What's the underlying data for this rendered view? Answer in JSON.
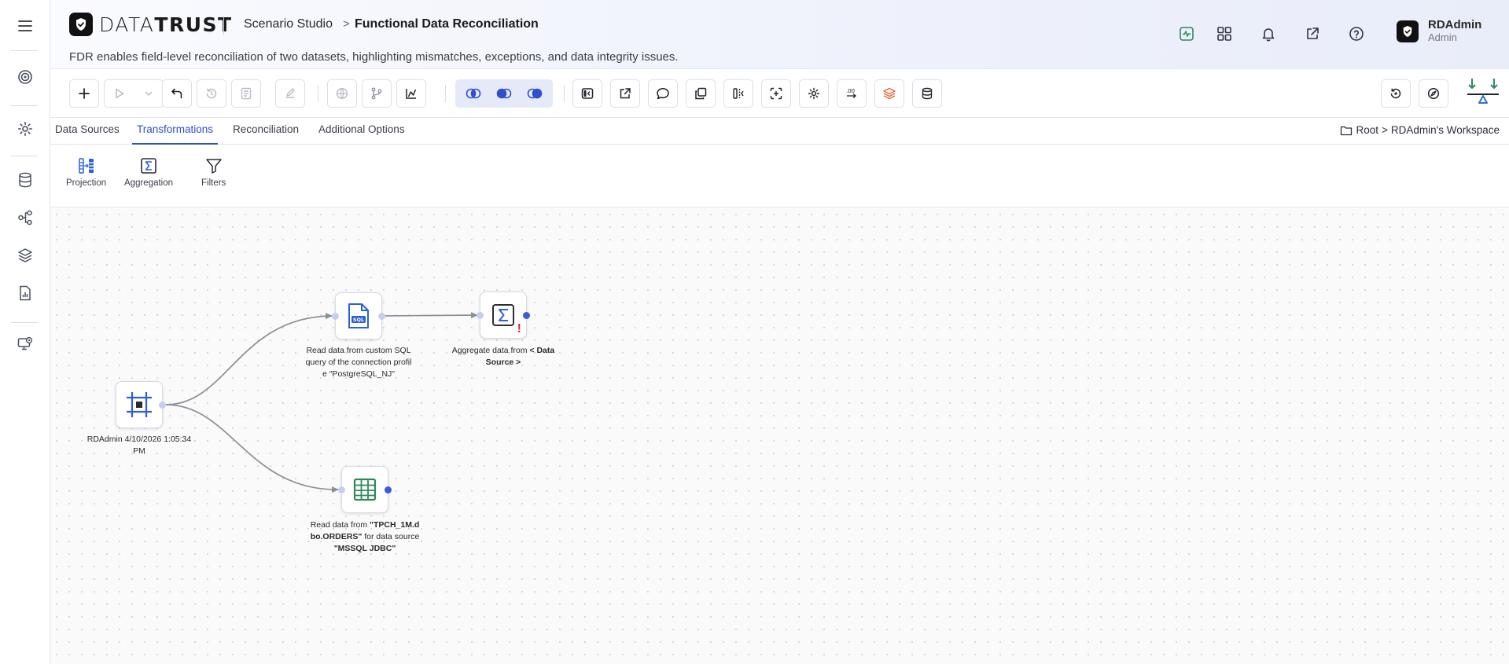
{
  "app": {
    "logo_text_light": "DATA",
    "logo_text_bold": "TRUST",
    "breadcrumb": "Scenario Studio",
    "breadcrumb_sep": ">",
    "page_title": "Functional Data Reconciliation",
    "subtitle": "FDR enables field-level reconciliation of two datasets, highlighting mismatches, exceptions, and data integrity issues."
  },
  "user": {
    "name": "RDAdmin",
    "role": "Admin"
  },
  "header_icons": [
    "activity-icon",
    "apps-grid-icon",
    "bell-icon",
    "external-link-icon",
    "help-icon"
  ],
  "tabs": [
    {
      "label": "Data Sources"
    },
    {
      "label": "Transformations"
    },
    {
      "label": "Reconciliation"
    },
    {
      "label": "Additional Options"
    }
  ],
  "active_tab": "Transformations",
  "workspace_path": {
    "root": "Root",
    "sep": ">",
    "workspace": "RDAdmin's Workspace"
  },
  "palette": [
    {
      "label": "Projection",
      "icon": "projection-icon"
    },
    {
      "label": "Aggregation",
      "icon": "sigma-icon"
    },
    {
      "label": "Filters",
      "icon": "filter-icon"
    }
  ],
  "nodes": {
    "start": {
      "label": "RDAdmin 4/10/2026 1:05:34 PM",
      "icon": "start-frame-icon"
    },
    "sql": {
      "label": "Read data from custom SQL query of the connection profile \"PostgreSQL_NJ\"",
      "icon": "sql-file-icon",
      "badge": "SQL"
    },
    "aggregate": {
      "prefix": "Aggregate data from ",
      "bold": "< Data Source >",
      "icon": "sigma-icon",
      "warning": "!"
    },
    "table": {
      "prefix": "Read data from ",
      "bold1": "\"TPCH_1M.dbo.ORDERS\"",
      "mid": " for data source ",
      "bold2": "\"MSSQL JDBC\"",
      "icon": "table-icon"
    }
  },
  "colors": {
    "accent": "#2e4fd1",
    "node_icon_blue": "#2f5fd8",
    "table_green": "#2e8a5a",
    "warning_red": "#e02424",
    "edge_gray": "#8c8f96"
  }
}
